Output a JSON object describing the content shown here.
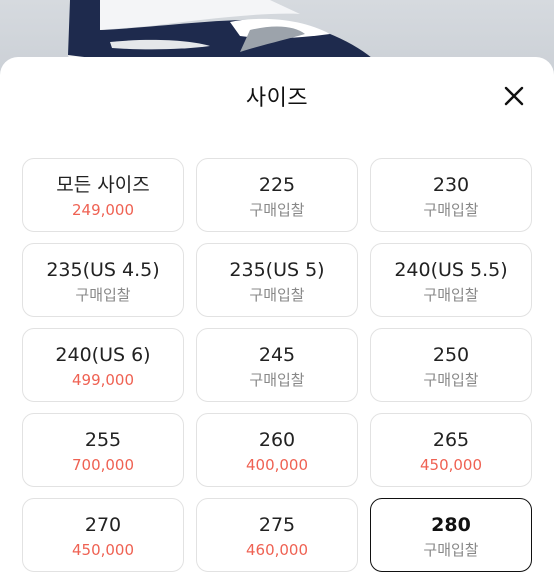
{
  "header": {
    "title": "사이즈"
  },
  "colors": {
    "accent": "#ef6253",
    "muted": "#888888"
  },
  "sizes": [
    {
      "size": "모든 사이즈",
      "price": "249,000",
      "tone": "red"
    },
    {
      "size": "225",
      "price": "구매입찰",
      "tone": "gray"
    },
    {
      "size": "230",
      "price": "구매입찰",
      "tone": "gray"
    },
    {
      "size": "235(US 4.5)",
      "price": "구매입찰",
      "tone": "gray"
    },
    {
      "size": "235(US 5)",
      "price": "구매입찰",
      "tone": "gray"
    },
    {
      "size": "240(US 5.5)",
      "price": "구매입찰",
      "tone": "gray"
    },
    {
      "size": "240(US 6)",
      "price": "499,000",
      "tone": "red"
    },
    {
      "size": "245",
      "price": "구매입찰",
      "tone": "gray"
    },
    {
      "size": "250",
      "price": "구매입찰",
      "tone": "gray"
    },
    {
      "size": "255",
      "price": "700,000",
      "tone": "red"
    },
    {
      "size": "260",
      "price": "400,000",
      "tone": "red"
    },
    {
      "size": "265",
      "price": "450,000",
      "tone": "red"
    },
    {
      "size": "270",
      "price": "450,000",
      "tone": "red"
    },
    {
      "size": "275",
      "price": "460,000",
      "tone": "red"
    },
    {
      "size": "280",
      "price": "구매입찰",
      "tone": "gray",
      "selected": true
    }
  ]
}
